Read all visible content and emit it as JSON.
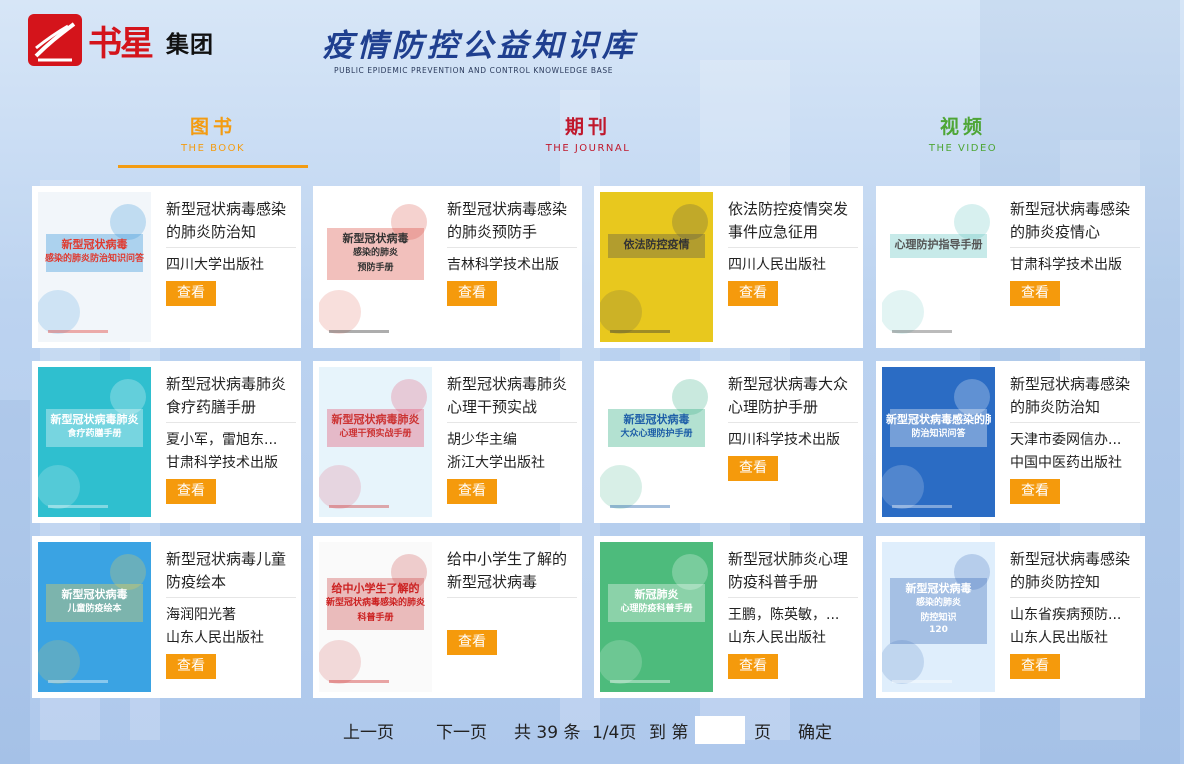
{
  "header": {
    "logo_text": "书星",
    "logo_group": "集团",
    "title": "疫情防控公益知识库",
    "subtitle": "PUBLIC EPIDEMIC PREVENTION AND CONTROL KNOWLEDGE BASE"
  },
  "tabs": [
    {
      "cn": "图书",
      "en": "THE BOOK",
      "active": true,
      "color": "#f39c12"
    },
    {
      "cn": "期刊",
      "en": "THE JOURNAL",
      "active": false,
      "color": "#c0182c"
    },
    {
      "cn": "视频",
      "en": "THE VIDEO",
      "active": false,
      "color": "#4ea636"
    }
  ],
  "view_label": "查看",
  "books": [
    {
      "title": "新型冠状病毒感染的肺炎防治知",
      "meta": [
        "四川大学出版社"
      ],
      "cover_lines": [
        "新型冠状病毒",
        "感染的肺炎防治知识问答"
      ]
    },
    {
      "title": "新型冠状病毒感染的肺炎预防手",
      "meta": [
        "吉林科学技术出版"
      ],
      "cover_lines": [
        "新型冠状病毒",
        "感染的肺炎",
        "预防手册"
      ]
    },
    {
      "title": "依法防控疫情突发事件应急征用",
      "meta": [
        "四川人民出版社"
      ],
      "cover_lines": [
        "依法防控疫情"
      ]
    },
    {
      "title": "新型冠状病毒感染的肺炎疫情心",
      "meta": [
        "甘肃科学技术出版"
      ],
      "cover_lines": [
        "心理防护指导手册"
      ]
    },
    {
      "title": "新型冠状病毒肺炎食疗药膳手册",
      "meta": [
        "夏小军，雷旭东...",
        "甘肃科学技术出版"
      ],
      "cover_lines": [
        "新型冠状病毒肺炎",
        "食疗药膳手册"
      ]
    },
    {
      "title": "新型冠状病毒肺炎心理干预实战",
      "meta": [
        "胡少华主编",
        "浙江大学出版社"
      ],
      "cover_lines": [
        "新型冠状病毒肺炎",
        "心理干预实战手册"
      ]
    },
    {
      "title": "新型冠状病毒大众心理防护手册",
      "meta": [
        "四川科学技术出版"
      ],
      "cover_lines": [
        "新型冠状病毒",
        "大众心理防护手册"
      ]
    },
    {
      "title": "新型冠状病毒感染的肺炎防治知",
      "meta": [
        "天津市委网信办...",
        "中国中医药出版社"
      ],
      "cover_lines": [
        "新型冠状病毒感染的肺炎",
        "防治知识问答"
      ]
    },
    {
      "title": "新型冠状病毒儿童防疫绘本",
      "meta": [
        "海润阳光著",
        "山东人民出版社"
      ],
      "cover_lines": [
        "新型冠状病毒",
        "儿童防疫绘本"
      ]
    },
    {
      "title": "给中小学生了解的新型冠状病毒",
      "meta": [],
      "cover_lines": [
        "给中小学生了解的",
        "新型冠状病毒感染的肺炎",
        "科普手册"
      ]
    },
    {
      "title": "新型冠状肺炎心理防疫科普手册",
      "meta": [
        "王鹏，陈英敏，...",
        "山东人民出版社"
      ],
      "cover_lines": [
        "新冠肺炎",
        "心理防疫科普手册"
      ]
    },
    {
      "title": "新型冠状病毒感染的肺炎防控知",
      "meta": [
        "山东省疾病预防...",
        "山东人民出版社"
      ],
      "cover_lines": [
        "新型冠状病毒",
        "感染的肺炎",
        "防控知识",
        "120"
      ]
    }
  ],
  "pager": {
    "prev": "上一页",
    "next": "下一页",
    "total": "共 39 条",
    "page": "1/4页",
    "goto": "到 第",
    "input_value": "",
    "unit": "页",
    "confirm": "确定"
  }
}
